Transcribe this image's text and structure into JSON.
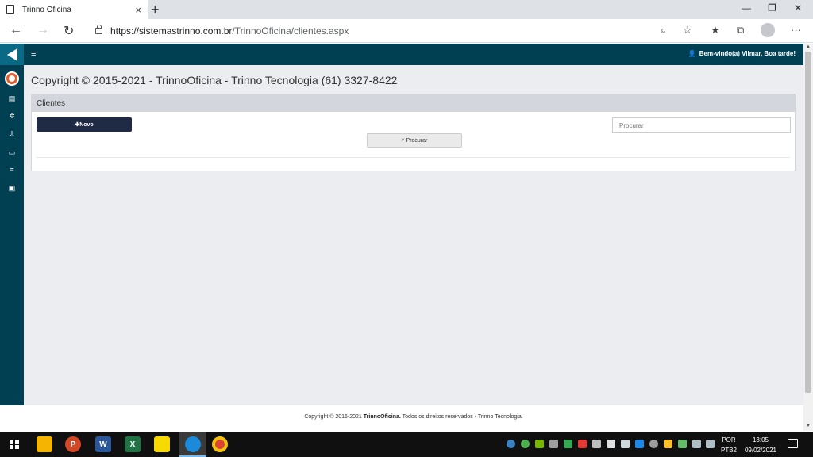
{
  "browser": {
    "tab_title": "Trinno Oficina",
    "tab_close": "×",
    "new_tab": "+",
    "url_host": "https://sistemastrinno.com.br",
    "url_path": "/TrinnoOficina/clientes.aspx",
    "more": "···"
  },
  "app": {
    "welcome": "Bem-vindo(a) Vilmar, Boa tarde!",
    "page_title": "Copyright © 2015-2021 - TrinnoOficina - Trinno Tecnologia (61) 3327-8422",
    "panel_title": "Clientes",
    "novo_label": "Novo",
    "search_placeholder": "Procurar",
    "procurar_label": "Procurar",
    "footer_prefix": "Copyright © 2016-2021 ",
    "footer_brand": "TrinnoOficina.",
    "footer_suffix": " Todos os direitos reservados - Trinno Tecnologia."
  },
  "taskbar": {
    "lang": "POR",
    "layout": "PTB2",
    "time": "13:05",
    "date": "09/02/2021",
    "apps": [
      "P",
      "W",
      "X"
    ]
  },
  "colors": {
    "brand_dark": "#004052",
    "brand_logo": "#0a6a85",
    "novo_button": "#1f2a44",
    "content_bg": "#ecedf1"
  }
}
